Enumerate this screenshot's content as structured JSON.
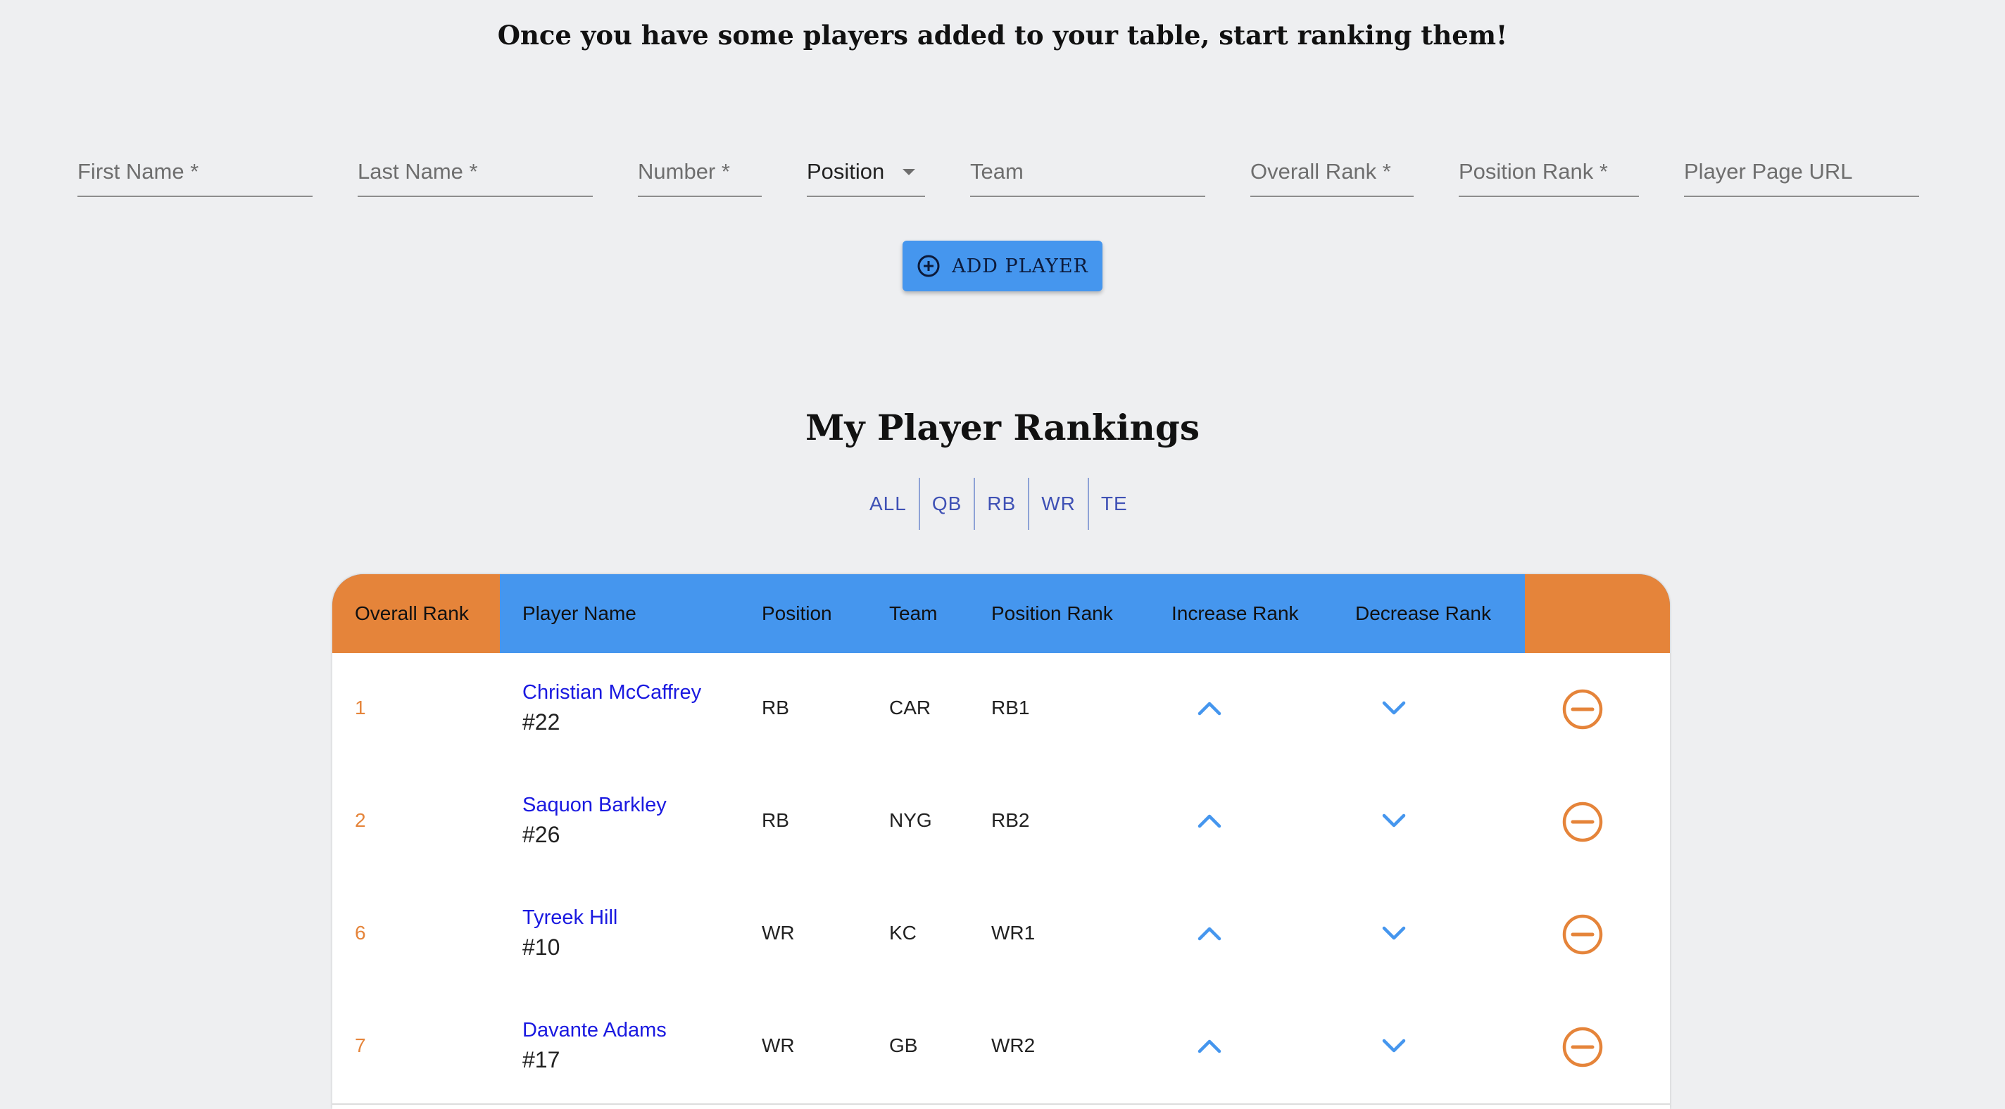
{
  "intro": "Once you have some players added to your table, start ranking them!",
  "form": {
    "first_name": "First Name *",
    "last_name": "Last Name *",
    "number": "Number *",
    "position": "Position",
    "team": "Team",
    "overall_rank": "Overall Rank *",
    "position_rank": "Position Rank *",
    "player_url": "Player Page URL"
  },
  "add_button": {
    "label": "ADD PLAYER",
    "icon": "plus-circle-icon"
  },
  "rankings_title": "My Player Rankings",
  "filters": [
    "ALL",
    "QB",
    "RB",
    "WR",
    "TE"
  ],
  "table": {
    "headers": {
      "overall_rank": "Overall Rank",
      "player_name": "Player Name",
      "position": "Position",
      "team": "Team",
      "position_rank": "Position Rank",
      "increase_rank": "Increase Rank",
      "decrease_rank": "Decrease Rank"
    },
    "rows": [
      {
        "rank": "1",
        "name": "Christian McCaffrey",
        "number": "#22",
        "position": "RB",
        "team": "CAR",
        "position_rank": "RB1"
      },
      {
        "rank": "2",
        "name": "Saquon Barkley",
        "number": "#26",
        "position": "RB",
        "team": "NYG",
        "position_rank": "RB2"
      },
      {
        "rank": "6",
        "name": "Tyreek Hill",
        "number": "#10",
        "position": "WR",
        "team": "KC",
        "position_rank": "WR1"
      },
      {
        "rank": "7",
        "name": "Davante Adams",
        "number": "#17",
        "position": "WR",
        "team": "GB",
        "position_rank": "WR2"
      }
    ],
    "icons": {
      "increase": "chevron-up-icon",
      "decrease": "chevron-down-icon",
      "remove": "minus-circle-icon"
    }
  },
  "colors": {
    "accent_blue": "#4596ee",
    "accent_orange": "#e5843a",
    "link_blue": "#1a19e0",
    "filter_blue": "#3f51b5"
  }
}
